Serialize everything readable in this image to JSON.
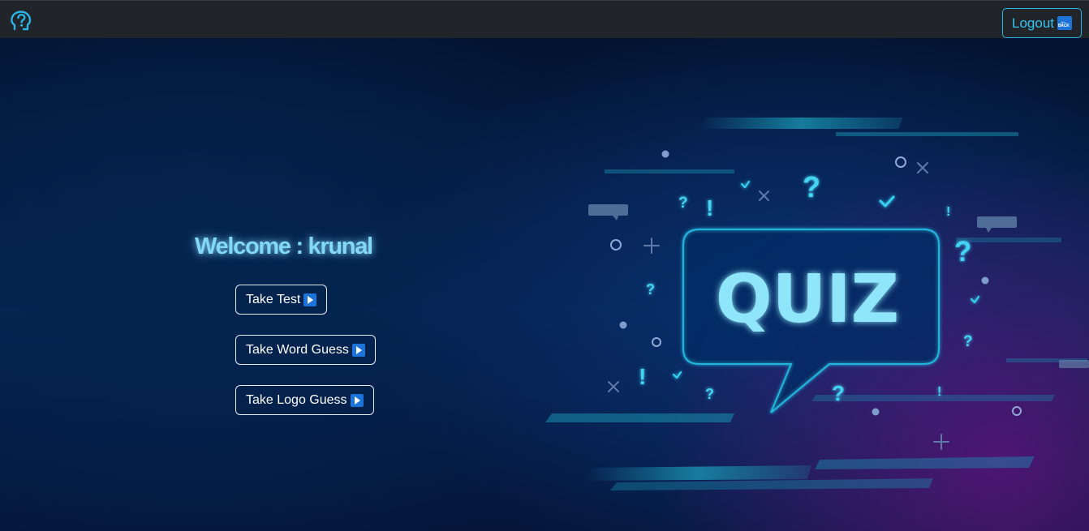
{
  "navbar": {
    "brand_icon": "question-head-icon",
    "logout_label": "Logout",
    "logout_icon": "back-arrow-icon"
  },
  "hero": {
    "welcome_label": "Welcome : krunal",
    "buttons": [
      {
        "label": "Take Test",
        "icon": "play-icon"
      },
      {
        "label": "Take Word Guess",
        "icon": "play-icon"
      },
      {
        "label": "Take Logo Guess",
        "icon": "play-icon"
      }
    ],
    "illustration_text": "QUIZ"
  },
  "colors": {
    "navbar_bg": "#212529",
    "accent_cyan": "#35c4f1",
    "welcome_glow": "#82d8f5",
    "icon_blue": "#1c74d9"
  }
}
